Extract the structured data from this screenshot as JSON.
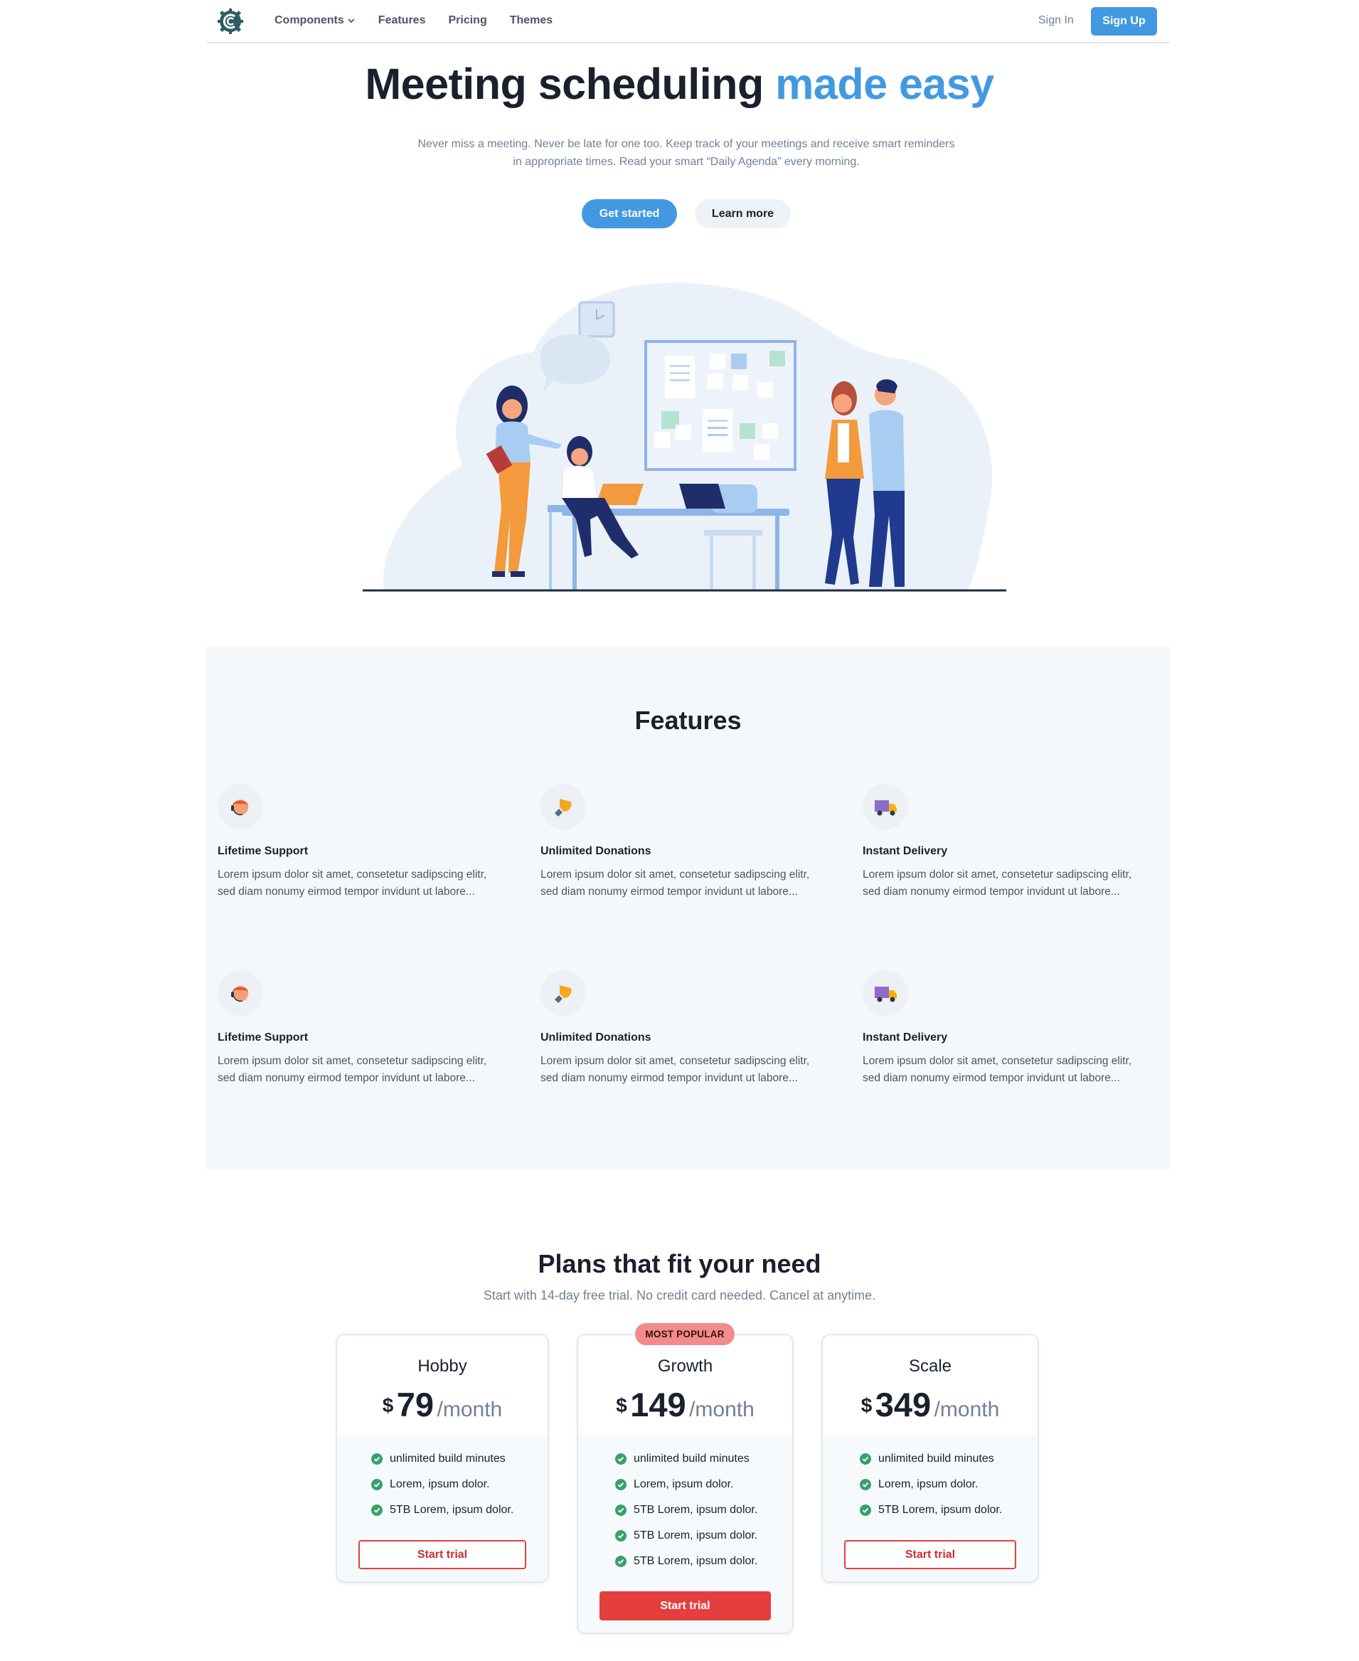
{
  "nav": {
    "links": [
      "Components",
      "Features",
      "Pricing",
      "Themes"
    ],
    "sign_in": "Sign In",
    "sign_up": "Sign Up",
    "logo_icon": "gear-logo-icon",
    "dropdown_icon": "chevron-down-icon"
  },
  "hero": {
    "title_main": "Meeting scheduling",
    "title_accent": "made easy",
    "subtitle_line1": "Never miss a meeting. Never be late for one too. Keep track of your meetings and receive smart reminders",
    "subtitle_line2": "in appropriate times. Read your smart “Daily Agenda” every morning.",
    "cta_primary": "Get started",
    "cta_secondary": "Learn more",
    "illustration": "team-meeting-illustration"
  },
  "features": {
    "title": "Features",
    "items": [
      {
        "icon": "support-agent-icon",
        "title": "Lifetime Support",
        "line1": "Lorem ipsum dolor sit amet, consetetur sadipscing elitr,",
        "line2": "sed diam nonumy eirmod tempor invidunt ut labore..."
      },
      {
        "icon": "donation-hand-icon",
        "title": "Unlimited Donations",
        "line1": "Lorem ipsum dolor sit amet, consetetur sadipscing elitr,",
        "line2": "sed diam nonumy eirmod tempor invidunt ut labore..."
      },
      {
        "icon": "delivery-truck-icon",
        "title": "Instant Delivery",
        "line1": "Lorem ipsum dolor sit amet, consetetur sadipscing elitr,",
        "line2": "sed diam nonumy eirmod tempor invidunt ut labore..."
      },
      {
        "icon": "support-agent-icon",
        "title": "Lifetime Support",
        "line1": "Lorem ipsum dolor sit amet, consetetur sadipscing elitr,",
        "line2": "sed diam nonumy eirmod tempor invidunt ut labore..."
      },
      {
        "icon": "donation-hand-icon",
        "title": "Unlimited Donations",
        "line1": "Lorem ipsum dolor sit amet, consetetur sadipscing elitr,",
        "line2": "sed diam nonumy eirmod tempor invidunt ut labore..."
      },
      {
        "icon": "delivery-truck-icon",
        "title": "Instant Delivery",
        "line1": "Lorem ipsum dolor sit amet, consetetur sadipscing elitr,",
        "line2": "sed diam nonumy eirmod tempor invidunt ut labore..."
      }
    ]
  },
  "pricing": {
    "title": "Plans that fit your need",
    "subtitle": "Start with 14-day free trial. No credit card needed. Cancel at anytime.",
    "badge": "MOST POPULAR",
    "currency": "$",
    "period": "/month",
    "plans": [
      {
        "name": "Hobby",
        "price": "79",
        "features": [
          "unlimited build minutes",
          "Lorem, ipsum dolor.",
          "5TB Lorem, ipsum dolor."
        ],
        "cta": "Start trial"
      },
      {
        "name": "Growth",
        "price": "149",
        "features": [
          "unlimited build minutes",
          "Lorem, ipsum dolor.",
          "5TB Lorem, ipsum dolor.",
          "5TB Lorem, ipsum dolor.",
          "5TB Lorem, ipsum dolor."
        ],
        "cta": "Start trial"
      },
      {
        "name": "Scale",
        "price": "349",
        "features": [
          "unlimited build minutes",
          "Lorem, ipsum dolor.",
          "5TB Lorem, ipsum dolor."
        ],
        "cta": "Start trial"
      }
    ]
  },
  "colors": {
    "accent": "#4299e1",
    "cta_red": "#e53e3e",
    "check_green": "#38a169",
    "badge": "#f28b8b"
  }
}
